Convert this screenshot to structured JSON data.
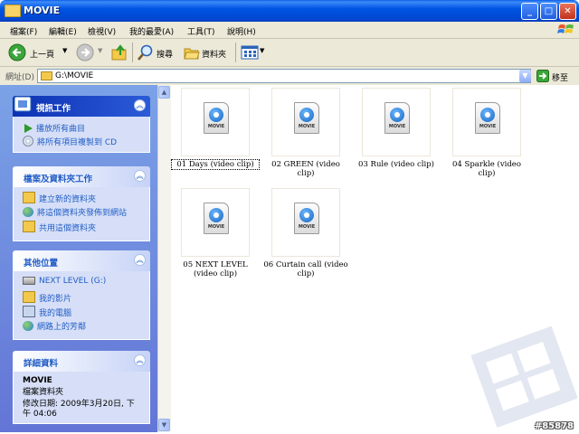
{
  "window": {
    "title": "MOVIE"
  },
  "menu": [
    "檔案(F)",
    "編輯(E)",
    "檢視(V)",
    "我的最愛(A)",
    "工具(T)",
    "說明(H)"
  ],
  "toolbar": {
    "back_label": "上一頁",
    "search_label": "搜尋",
    "folders_label": "資料夾"
  },
  "address": {
    "label": "網址(D)",
    "value": "G:\\MOVIE",
    "go_label": "移至"
  },
  "panels": {
    "video_tasks": {
      "title": "視訊工作",
      "items": [
        "播放所有曲目",
        "將所有項目複製到 CD"
      ]
    },
    "file_tasks": {
      "title": "檔案及資料夾工作",
      "items": [
        "建立新的資料夾",
        "將這個資料夾發佈到網站",
        "共用這個資料夾"
      ]
    },
    "other_places": {
      "title": "其他位置",
      "items": [
        "NEXT LEVEL (G:)",
        "我的影片",
        "我的電腦",
        "網路上的芳鄰"
      ]
    },
    "details": {
      "title": "詳細資料",
      "name": "MOVIE",
      "type": "檔案資料夾",
      "modified_line1": "修改日期: 2009年3月20日, 下",
      "modified_line2": "午 04:06"
    }
  },
  "files": [
    {
      "caption": "01 Days (video clip)"
    },
    {
      "caption": "02 GREEN (video clip)"
    },
    {
      "caption": "03 Rule (video clip)"
    },
    {
      "caption": "04 Sparkle (video clip)"
    },
    {
      "caption": "05 NEXT LEVEL (video clip)"
    },
    {
      "caption": "06 Curtain call (video clip)"
    }
  ],
  "file_icon_label": "MOVIE",
  "watermark": "#85878"
}
